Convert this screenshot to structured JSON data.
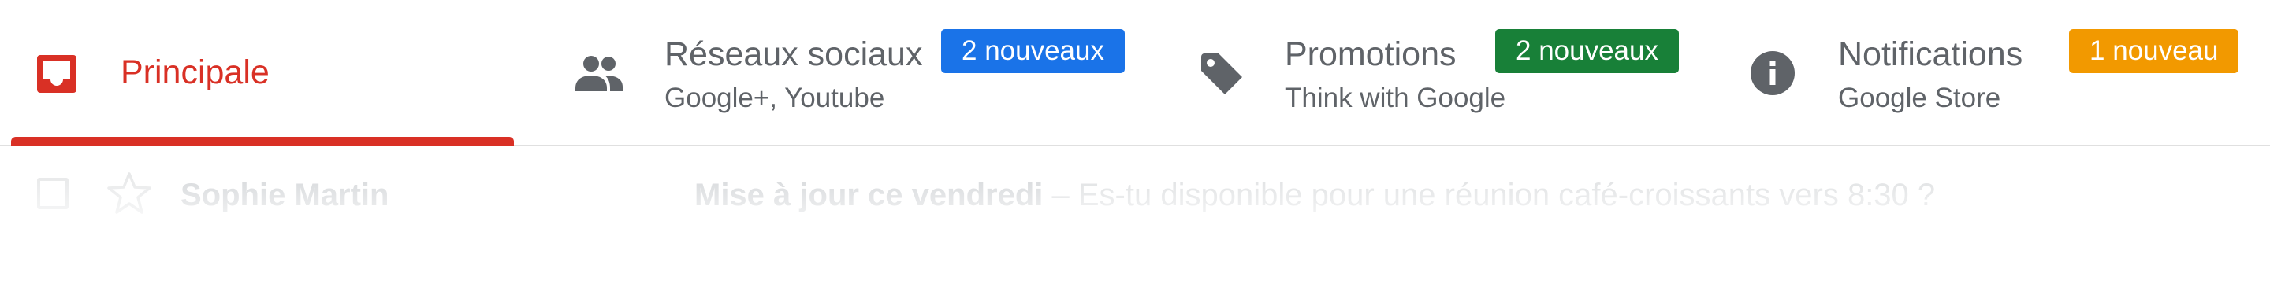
{
  "tabs": {
    "primary": {
      "label": "Principale",
      "icon": "inbox-icon",
      "color": "#d93025"
    },
    "social": {
      "title": "Réseaux sociaux",
      "subtitle": "Google+, Youtube",
      "badge": "2 nouveaux",
      "badge_color": "#1a73e8",
      "icon": "people-icon"
    },
    "promotions": {
      "title": "Promotions",
      "subtitle": "Think with Google",
      "badge": "2 nouveaux",
      "badge_color": "#188038",
      "icon": "tag-icon"
    },
    "notifications": {
      "title": "Notifications",
      "subtitle": "Google Store",
      "badge": "1 nouveau",
      "badge_color": "#f29900",
      "icon": "info-icon"
    }
  },
  "mail": {
    "sender": "Sophie Martin",
    "subject": "Mise à jour ce vendredi",
    "separator": " – ",
    "snippet": "Es-tu disponible pour une réunion café-croissants vers 8:30 ?"
  }
}
